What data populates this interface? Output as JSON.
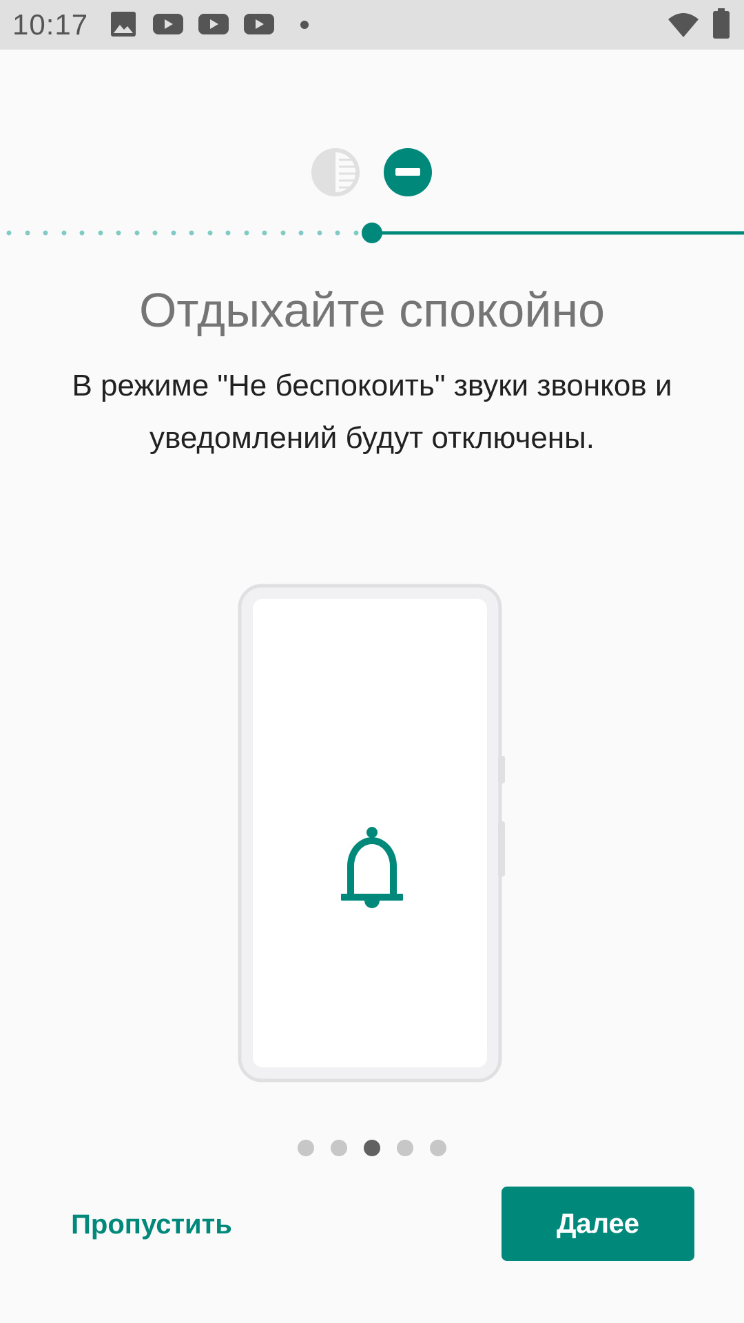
{
  "status_bar": {
    "time": "10:17",
    "notification_icons": [
      "image-icon",
      "youtube-icon",
      "youtube-icon",
      "youtube-icon",
      "more-dot-icon"
    ],
    "system_icons": [
      "wifi-icon",
      "battery-icon"
    ]
  },
  "mode_icons": [
    "contrast-icon",
    "do-not-disturb-icon"
  ],
  "title": "Отдыхайте спокойно",
  "description": "В режиме \"Не беспокоить\" звуки звонков и уведомлений будут отключены.",
  "illustration": {
    "icon": "bell-icon"
  },
  "pager": {
    "count": 5,
    "active_index": 2
  },
  "buttons": {
    "skip": "Пропустить",
    "next": "Далее"
  },
  "colors": {
    "accent": "#00897b",
    "dot_inactive": "#c7c7c7",
    "dot_active": "#616161"
  }
}
